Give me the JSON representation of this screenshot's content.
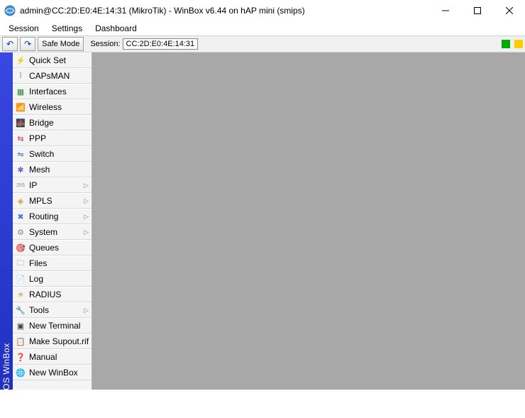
{
  "titlebar": {
    "title": "admin@CC:2D:E0:4E:14:31 (MikroTik) - WinBox v6.44 on hAP mini (smips)"
  },
  "menubar": {
    "items": [
      "Session",
      "Settings",
      "Dashboard"
    ]
  },
  "toolbar": {
    "undo_symbol": "↶",
    "redo_symbol": "↷",
    "safe_mode": "Safe Mode",
    "session_label": "Session:",
    "session_value": "CC:2D:E0:4E:14:31"
  },
  "leftbar": {
    "label": "RouterOS WinBox"
  },
  "sidebar": {
    "items": [
      {
        "label": "Quick Set",
        "icon": "⚡",
        "icon_color": "#d08000",
        "submenu": false
      },
      {
        "label": "CAPsMAN",
        "icon": "î",
        "icon_color": "#888888",
        "submenu": false
      },
      {
        "label": "Interfaces",
        "icon": "▦",
        "icon_color": "#2a8a2a",
        "submenu": false
      },
      {
        "label": "Wireless",
        "icon": "📶",
        "icon_color": "#3b7bd6",
        "submenu": false
      },
      {
        "label": "Bridge",
        "icon": "🌉",
        "icon_color": "#3b7bd6",
        "submenu": false
      },
      {
        "label": "PPP",
        "icon": "⇆",
        "icon_color": "#c04848",
        "submenu": false
      },
      {
        "label": "Switch",
        "icon": "⇋",
        "icon_color": "#3b7bd6",
        "submenu": false
      },
      {
        "label": "Mesh",
        "icon": "✱",
        "icon_color": "#6a6ad0",
        "submenu": false
      },
      {
        "label": "IP",
        "icon": "255",
        "icon_color": "#888888",
        "submenu": true
      },
      {
        "label": "MPLS",
        "icon": "◈",
        "icon_color": "#d0a030",
        "submenu": true
      },
      {
        "label": "Routing",
        "icon": "✖",
        "icon_color": "#3b7bd6",
        "submenu": true
      },
      {
        "label": "System",
        "icon": "⚙",
        "icon_color": "#888888",
        "submenu": true
      },
      {
        "label": "Queues",
        "icon": "🎯",
        "icon_color": "#7a5a3a",
        "submenu": false
      },
      {
        "label": "Files",
        "icon": "🗀",
        "icon_color": "#5a8ad0",
        "submenu": false
      },
      {
        "label": "Log",
        "icon": "📄",
        "icon_color": "#888888",
        "submenu": false
      },
      {
        "label": "RADIUS",
        "icon": "☀",
        "icon_color": "#d0a030",
        "submenu": false
      },
      {
        "label": "Tools",
        "icon": "🔧",
        "icon_color": "#888888",
        "submenu": true
      },
      {
        "label": "New Terminal",
        "icon": "▣",
        "icon_color": "#444444",
        "submenu": false
      },
      {
        "label": "Make Supout.rif",
        "icon": "📋",
        "icon_color": "#888888",
        "submenu": false
      },
      {
        "label": "Manual",
        "icon": "❓",
        "icon_color": "#3b7bd6",
        "submenu": false
      },
      {
        "label": "New WinBox",
        "icon": "🌐",
        "icon_color": "#3b7bd6",
        "submenu": false
      }
    ]
  }
}
